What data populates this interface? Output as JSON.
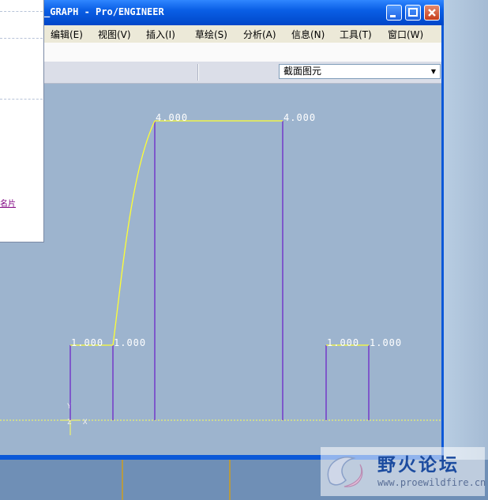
{
  "window": {
    "title": "_GRAPH - Pro/ENGINEER"
  },
  "menu": [
    {
      "label": "编辑(E)"
    },
    {
      "label": "视图(V)"
    },
    {
      "label": "插入(I)"
    },
    {
      "label": "草绘(S)"
    },
    {
      "label": "分析(A)"
    },
    {
      "label": "信息(N)"
    },
    {
      "label": "工具(T)"
    },
    {
      "label": "窗口(W)"
    }
  ],
  "toolbar": {
    "filter_value": "截面图元"
  },
  "left_panel": {
    "link_text": "名片"
  },
  "graph": {
    "dimensions": [
      "1.000",
      "1.000",
      "4.000",
      "4.000",
      "1.000",
      "1.000"
    ],
    "axis_labels": {
      "y": "Y",
      "z": "Z",
      "x": "X"
    },
    "colors": {
      "curve": "#ffff33",
      "vertical": "#7030c8",
      "axis": "#ffff55",
      "background": "#9db4ce"
    }
  },
  "watermark": {
    "title": "野火论坛",
    "url": "www.proewildfire.cn"
  }
}
